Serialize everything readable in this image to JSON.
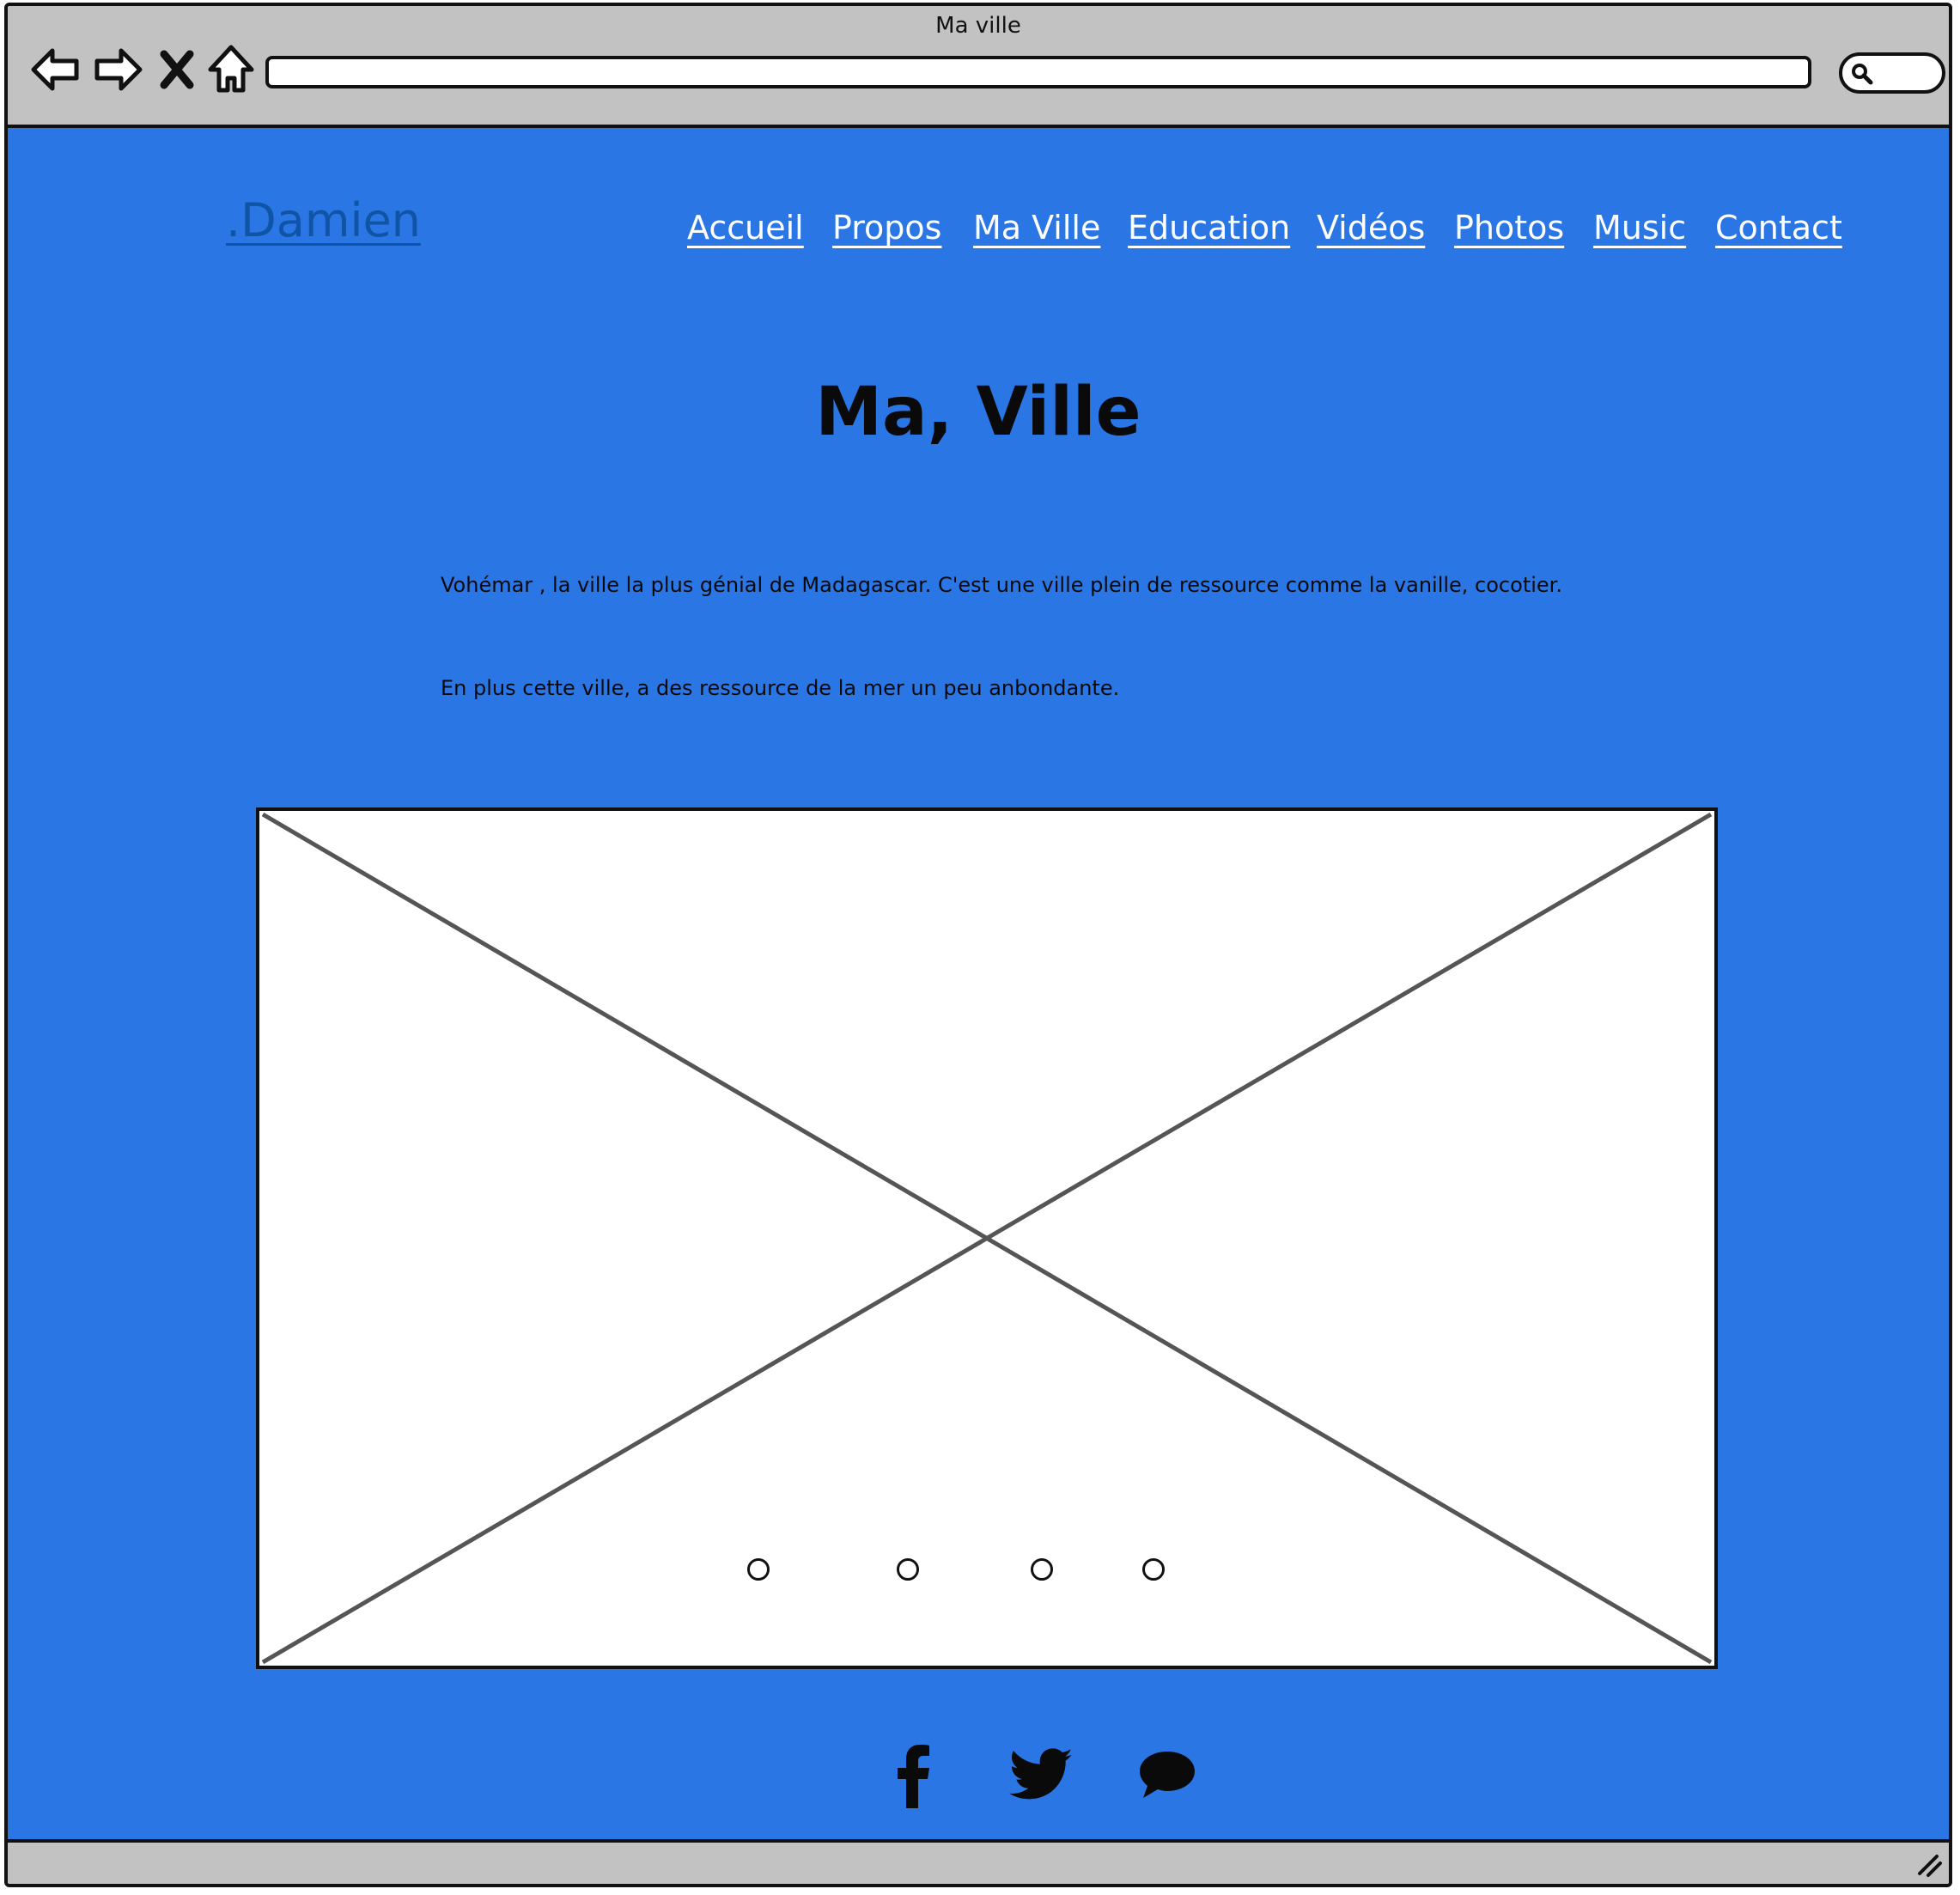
{
  "window": {
    "title": "Ma ville"
  },
  "browser": {
    "nav_icons": [
      "back-arrow-icon",
      "forward-arrow-icon",
      "close-x-icon",
      "home-icon"
    ],
    "url": "",
    "search_icon": "search-icon",
    "resize_icon": "resize-grip-icon"
  },
  "header": {
    "brand": ".Damien",
    "nav": [
      "Accueil",
      "Propos",
      "Ma Ville",
      "Education",
      "Vidéos",
      "Photos",
      "Music",
      "Contact"
    ]
  },
  "main": {
    "title": "Ma, Ville",
    "paragraphs": [
      "Vohémar , la ville la plus génial de Madagascar. C'est une ville plein de ressource comme la vanille, cocotier.",
      "En plus cette ville, a des ressource de la mer un peu anbondante."
    ],
    "carousel": {
      "placeholder": "image-placeholder",
      "slide_count": 4
    }
  },
  "footer": {
    "social_icons": [
      "facebook-icon",
      "twitter-icon",
      "chat-bubble-icon"
    ]
  },
  "colors": {
    "page_background": "#2b76e5",
    "chrome": "#c2c2c2",
    "brand_link": "#0f54a5",
    "nav_link": "#ffffff",
    "text": "#0a0a0a"
  }
}
